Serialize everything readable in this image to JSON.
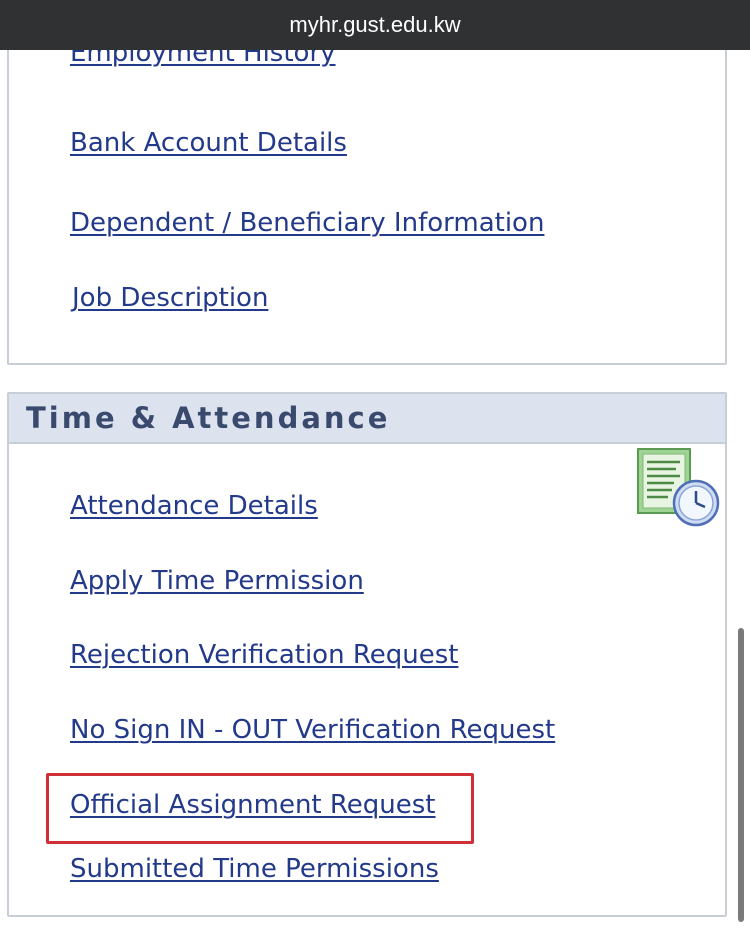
{
  "browser": {
    "url": "myhr.gust.edu.kw"
  },
  "personal_section": {
    "links": [
      "Employment History",
      "Bank Account Details",
      "Dependent / Beneficiary Information",
      "Job Description"
    ]
  },
  "time_attendance": {
    "title": "Time & Attendance",
    "icon": "timesheet-clock-icon",
    "links": [
      "Attendance Details",
      "Apply Time Permission",
      "Rejection Verification Request",
      "No Sign IN - OUT Verification Request",
      "Official Assignment Request",
      "Submitted Time Permissions"
    ],
    "highlighted_link": "Official Assignment Request",
    "highlight_color": "#cf2f36"
  },
  "colors": {
    "link": "#23398a",
    "header_bg": "#dde3ee",
    "header_text": "#3a4a6e",
    "url_bar_bg": "#2f3133"
  }
}
